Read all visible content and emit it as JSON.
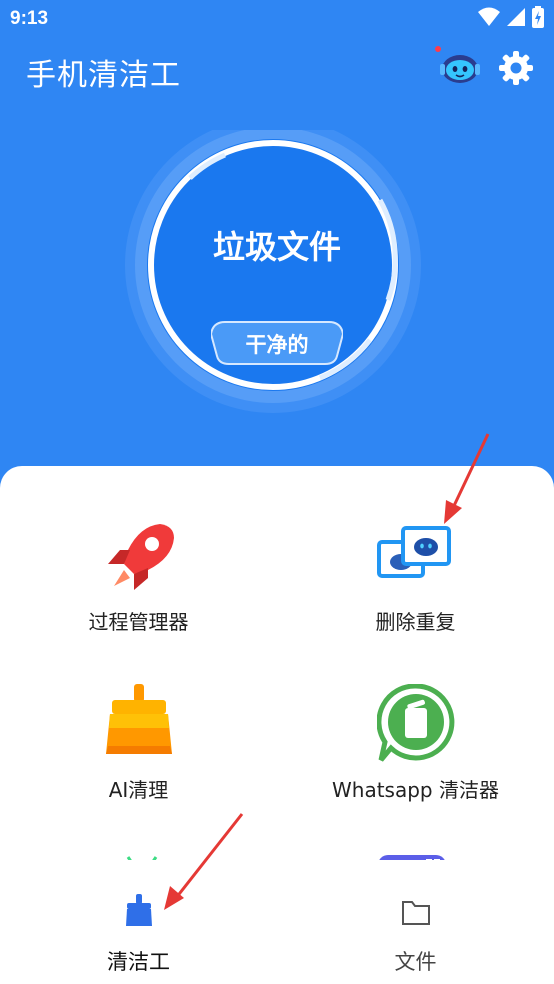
{
  "status_bar": {
    "time": "9:13"
  },
  "header": {
    "title": "手机清洁工",
    "robot_icon": "robot-assistant-icon",
    "settings_icon": "gear-icon"
  },
  "gauge": {
    "title": "垃圾文件",
    "status": "干净的"
  },
  "features": [
    {
      "label": "过程管理器",
      "icon": "rocket-icon"
    },
    {
      "label": "删除重复",
      "icon": "duplicate-photos-icon"
    },
    {
      "label": "AI清理",
      "icon": "broom-icon"
    },
    {
      "label": "Whatsapp 清洁器",
      "icon": "whatsapp-trash-icon"
    }
  ],
  "bottom_nav": [
    {
      "label": "清洁工",
      "icon": "broom-nav-icon",
      "active": true
    },
    {
      "label": "文件",
      "icon": "folder-icon",
      "active": false
    }
  ],
  "colors": {
    "primary": "#2f86f3",
    "accent_red": "#e53935",
    "text_dark": "#222222",
    "text_muted": "#444444"
  }
}
